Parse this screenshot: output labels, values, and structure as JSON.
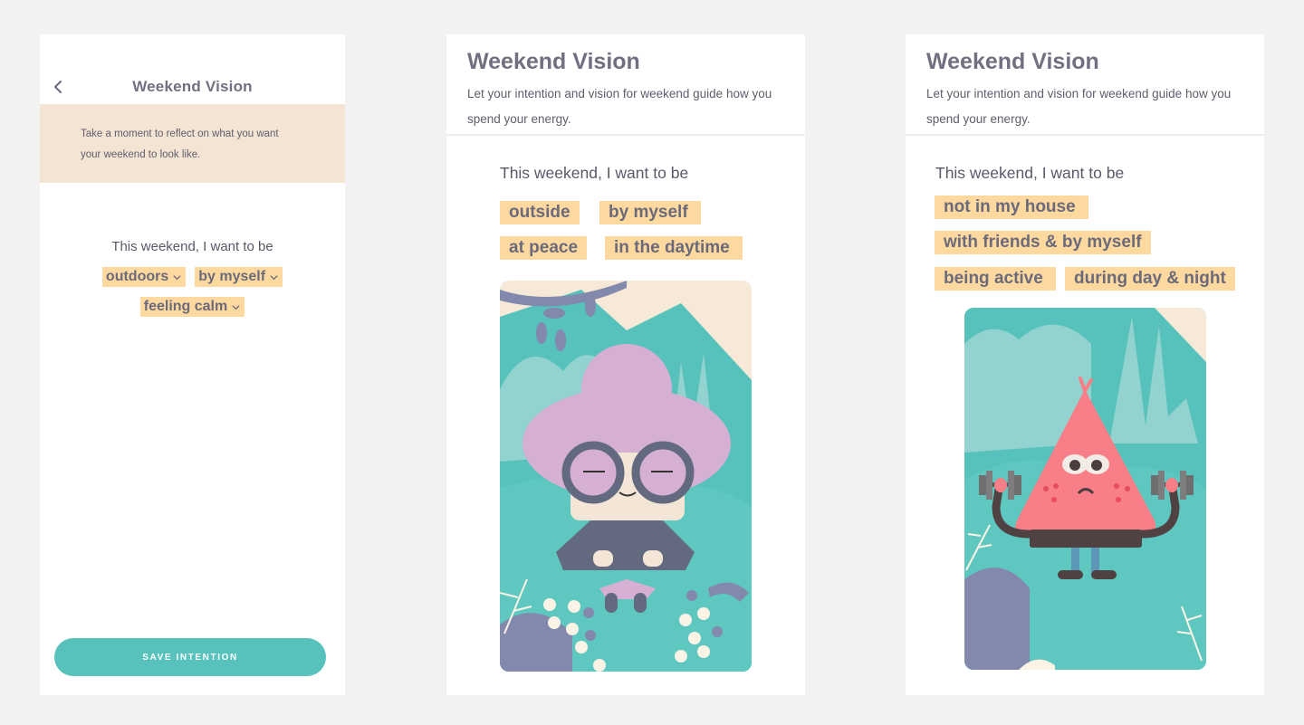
{
  "colors": {
    "background": "#f2f2f2",
    "panel": "#ffffff",
    "banner": "#f4e4d4",
    "chip": "#fdd9a0",
    "accent_teal": "#56c2bb",
    "text": "#6b6a7a"
  },
  "screens": [
    {
      "id": "intention-setup",
      "header": {
        "back_icon": "chevron-left-icon",
        "title": "Weekend Vision"
      },
      "banner_text": "Take a moment to reflect on what you want your weekend to look like.",
      "prompt": "This weekend, I want to be",
      "selections": [
        {
          "label": "outdoors",
          "icon": "chevron-down-icon"
        },
        {
          "label": "by myself",
          "icon": "chevron-down-icon"
        },
        {
          "label": "feeling calm",
          "icon": "chevron-down-icon"
        }
      ],
      "save_button": "SAVE INTENTION"
    },
    {
      "id": "vision-calm",
      "title": "Weekend Vision",
      "subtitle": "Let your intention and vision for weekend guide how you spend your energy.",
      "prompt": "This weekend, I want to be",
      "selections": [
        "outside",
        "by myself",
        "at peace",
        "in the daytime"
      ],
      "illustration": "meditating-character-with-purple-hair-and-glasses"
    },
    {
      "id": "vision-active",
      "title": "Weekend Vision",
      "subtitle": "Let your intention and vision for weekend guide how you spend your energy.",
      "prompt": "This weekend, I want to be",
      "selections": [
        "not in my house",
        "with friends & by myself",
        "being active",
        "during day & night"
      ],
      "illustration": "pink-triangle-character-lifting-dumbbells"
    }
  ]
}
